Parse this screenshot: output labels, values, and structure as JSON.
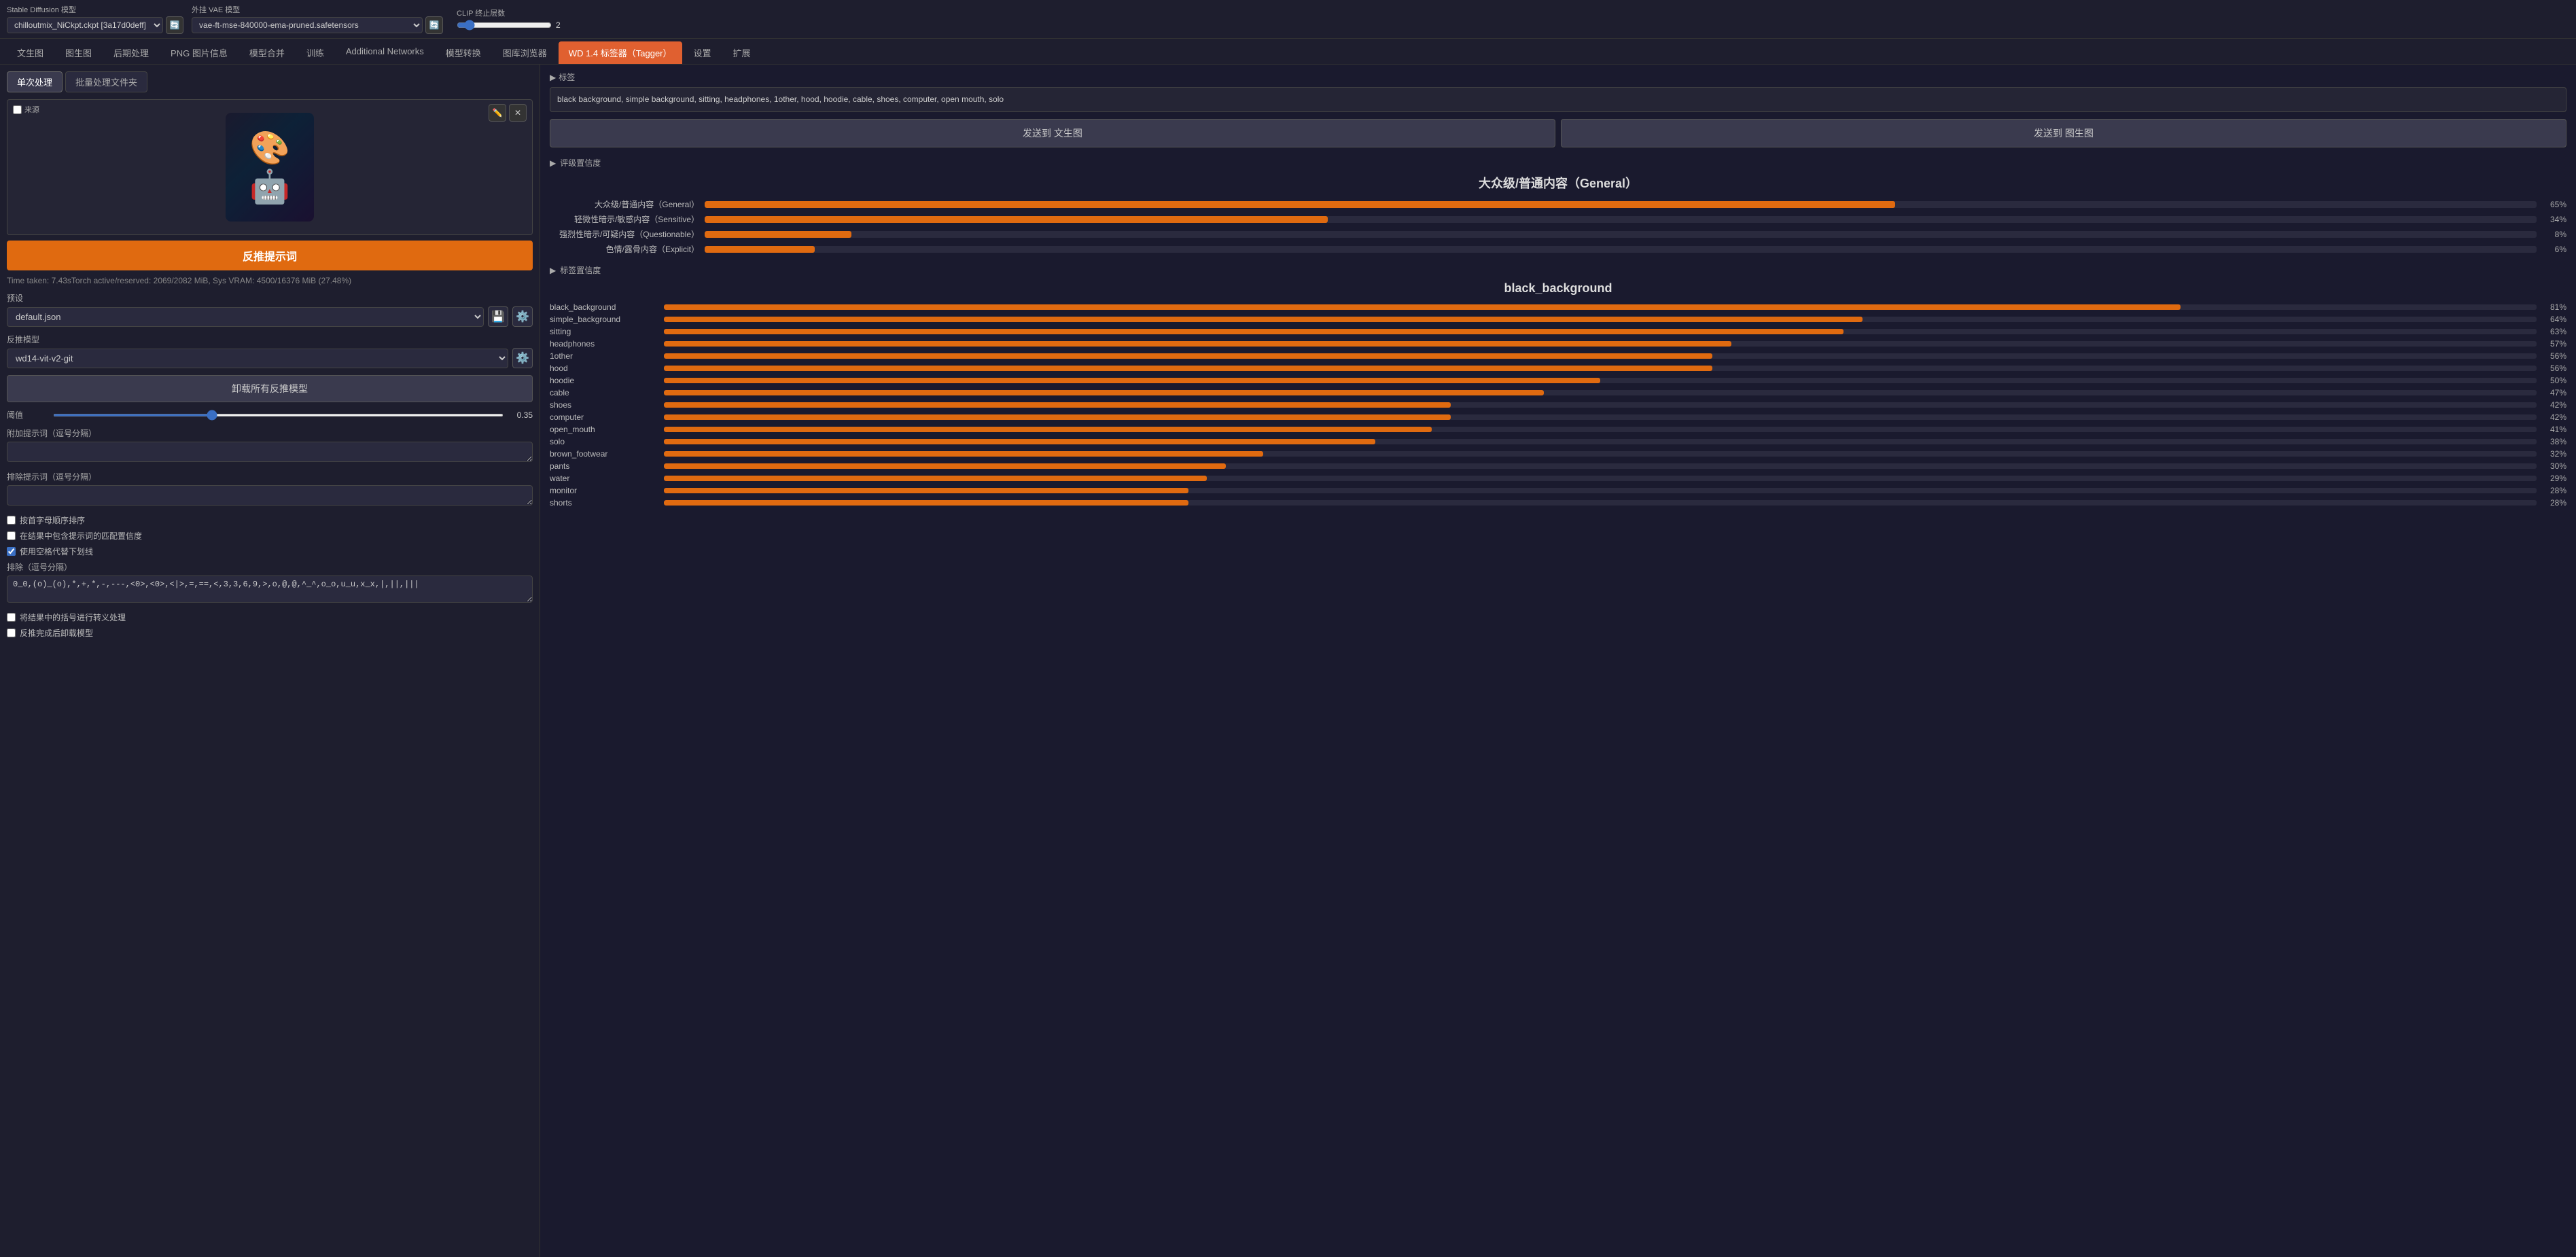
{
  "topbar": {
    "sd_model_label": "Stable Diffusion 模型",
    "sd_model_value": "chilloutmix_NiCkpt.ckpt [3a17d0deff]",
    "vae_model_label": "外挂 VAE 模型",
    "vae_model_value": "vae-ft-mse-840000-ema-pruned.safetensors",
    "clip_label": "CLIP 终止层数",
    "clip_value": "2"
  },
  "nav_tabs": [
    {
      "id": "txt2img",
      "label": "文生图"
    },
    {
      "id": "img2img",
      "label": "图生图"
    },
    {
      "id": "extras",
      "label": "后期处理"
    },
    {
      "id": "pnginfo",
      "label": "PNG 图片信息"
    },
    {
      "id": "merge",
      "label": "模型合并"
    },
    {
      "id": "train",
      "label": "训练"
    },
    {
      "id": "addnets",
      "label": "Additional Networks"
    },
    {
      "id": "convert",
      "label": "模型转换"
    },
    {
      "id": "browser",
      "label": "图库浏览器"
    },
    {
      "id": "tagger",
      "label": "WD 1.4 标签器（Tagger）",
      "active": true
    },
    {
      "id": "settings",
      "label": "设置"
    },
    {
      "id": "extensions",
      "label": "扩展"
    }
  ],
  "sub_tabs": [
    {
      "id": "single",
      "label": "单次处理",
      "active": true
    },
    {
      "id": "batch",
      "label": "批量处理文件夹"
    }
  ],
  "left_panel": {
    "source_label": "来源",
    "interrogate_btn": "反推提示词",
    "status_text": "Time taken: 7.43sTorch active/reserved: 2069/2082 MiB, Sys VRAM: 4500/16376 MiB (27.48%)",
    "preset_label": "预设",
    "preset_value": "default.json",
    "model_label": "反推模型",
    "model_value": "wd14-vit-v2-git",
    "unload_btn": "卸载所有反推模型",
    "threshold_label": "阈值",
    "threshold_value": "0.35",
    "additional_tags_label": "附加提示词（逗号分隔）",
    "additional_tags_placeholder": "",
    "exclude_tags_label": "排除提示词（逗号分隔）",
    "exclude_tags_placeholder": "",
    "checkbox_alpha": "按首字母顺序排序",
    "checkbox_replace": "在结果中包含提示词的匹配置信度",
    "checkbox_underscore": "使用空格代替下划线",
    "exclude_tokens_label": "排除（逗号分隔）",
    "exclude_tokens_value": "0_0,(o)_(o),*,+,*,-,---,<0>,<0>,<|>,=,==,<,3,3,6,9,>,o,@,@,^_^,o_o,u_u,x_x,|,||,|||",
    "checkbox_escape": "将结果中的括号进行转义处理",
    "checkbox_unload": "反推完成后卸载模型"
  },
  "right_panel": {
    "tags_header": "标签",
    "tags_value": "black background, simple background, sitting, headphones, 1other, hood, hoodie, cable, shoes, computer, open mouth, solo",
    "send_txt2img": "发送到 文生图",
    "send_img2img": "发送到 图生图",
    "rating_header": "评级置信度",
    "rating_title": "大众级/普通内容（General）",
    "rating_bars": [
      {
        "label": "大众级/普通内容（General）",
        "pct": 65,
        "pct_label": "65%"
      },
      {
        "label": "轻微性暗示/敏感内容（Sensitive）",
        "pct": 34,
        "pct_label": "34%"
      },
      {
        "label": "强烈性暗示/可疑内容（Questionable）",
        "pct": 8,
        "pct_label": "8%"
      },
      {
        "label": "色情/露骨内容（Explicit）",
        "pct": 6,
        "pct_label": "6%"
      }
    ],
    "tags_header2": "标签置信度",
    "tags_title": "black_background",
    "tag_bars": [
      {
        "label": "black_background",
        "pct": 81,
        "pct_label": "81%"
      },
      {
        "label": "simple_background",
        "pct": 64,
        "pct_label": "64%"
      },
      {
        "label": "sitting",
        "pct": 63,
        "pct_label": "63%"
      },
      {
        "label": "headphones",
        "pct": 57,
        "pct_label": "57%"
      },
      {
        "label": "1other",
        "pct": 56,
        "pct_label": "56%"
      },
      {
        "label": "hood",
        "pct": 56,
        "pct_label": "56%"
      },
      {
        "label": "hoodie",
        "pct": 50,
        "pct_label": "50%"
      },
      {
        "label": "cable",
        "pct": 47,
        "pct_label": "47%"
      },
      {
        "label": "shoes",
        "pct": 42,
        "pct_label": "42%"
      },
      {
        "label": "computer",
        "pct": 42,
        "pct_label": "42%"
      },
      {
        "label": "open_mouth",
        "pct": 41,
        "pct_label": "41%"
      },
      {
        "label": "solo",
        "pct": 38,
        "pct_label": "38%"
      },
      {
        "label": "brown_footwear",
        "pct": 32,
        "pct_label": "32%"
      },
      {
        "label": "pants",
        "pct": 30,
        "pct_label": "30%"
      },
      {
        "label": "water",
        "pct": 29,
        "pct_label": "29%"
      },
      {
        "label": "monitor",
        "pct": 28,
        "pct_label": "28%"
      },
      {
        "label": "shorts",
        "pct": 28,
        "pct_label": "28%"
      }
    ]
  },
  "icons": {
    "refresh": "🔄",
    "pencil": "✏️",
    "close": "✕",
    "folder": "📁",
    "settings": "⚙️",
    "triangle_down": "▼",
    "triangle_right": "▶"
  }
}
